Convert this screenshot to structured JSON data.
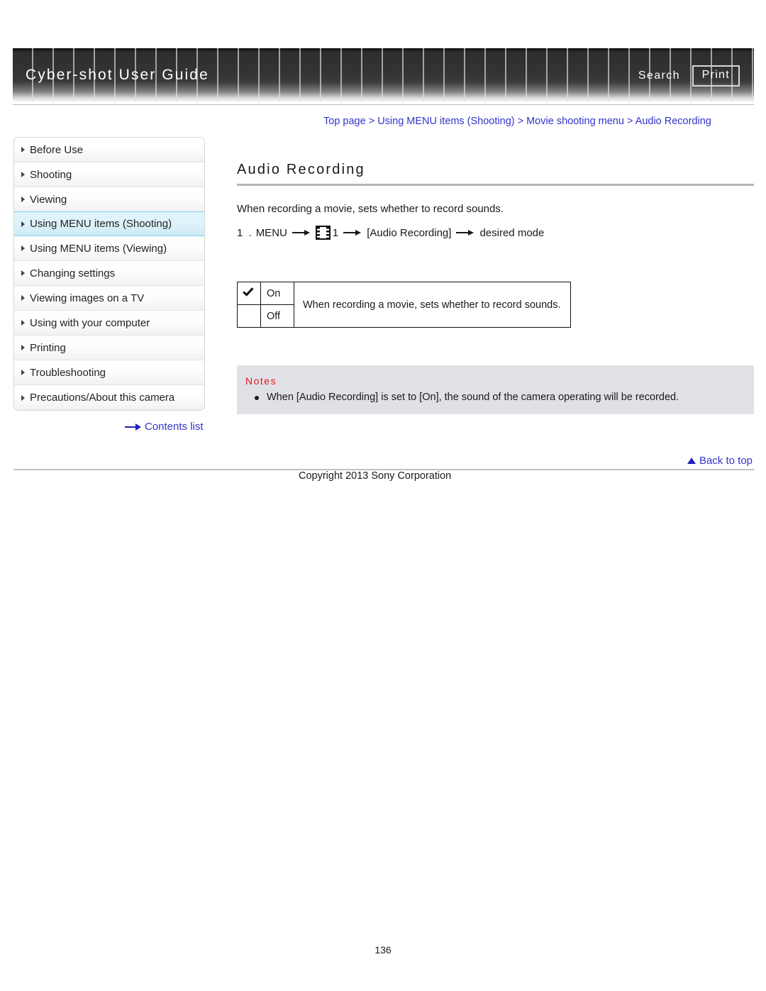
{
  "header": {
    "title": "Cyber-shot User Guide",
    "search_label": "Search",
    "print_label": "Print"
  },
  "breadcrumb": {
    "text": "Top page > Using MENU items (Shooting) > Movie shooting menu > Audio Recording"
  },
  "sidebar": {
    "items": [
      {
        "label": "Before Use",
        "active": false
      },
      {
        "label": "Shooting",
        "active": false
      },
      {
        "label": "Viewing",
        "active": false
      },
      {
        "label": "Using MENU items (Shooting)",
        "active": true
      },
      {
        "label": "Using MENU items (Viewing)",
        "active": false
      },
      {
        "label": "Changing settings",
        "active": false
      },
      {
        "label": "Viewing images on a TV",
        "active": false
      },
      {
        "label": "Using with your computer",
        "active": false
      },
      {
        "label": "Printing",
        "active": false
      },
      {
        "label": "Troubleshooting",
        "active": false
      },
      {
        "label": "Precautions/About this camera",
        "active": false
      }
    ],
    "contents_link": "Contents list"
  },
  "main": {
    "title": "Audio Recording",
    "intro": "When recording a movie, sets whether to record sounds.",
    "step": {
      "number": "1 .",
      "menu_label": "MENU",
      "icon": "film-strip-icon",
      "icon_index": "1",
      "item_label": "[Audio Recording]",
      "target_label": "desired mode"
    },
    "options_table": {
      "rows": [
        {
          "checked": true,
          "name": "On"
        },
        {
          "checked": false,
          "name": "Off"
        }
      ],
      "description": "When recording a movie, sets whether to record sounds."
    },
    "notes": {
      "title": "Notes",
      "items": [
        "When [Audio Recording] is set to [On], the sound of the camera operating will be recorded."
      ]
    }
  },
  "footer": {
    "back_to_top": "Back to top",
    "copyright": "Copyright 2013 Sony Corporation",
    "page_number": "136"
  }
}
